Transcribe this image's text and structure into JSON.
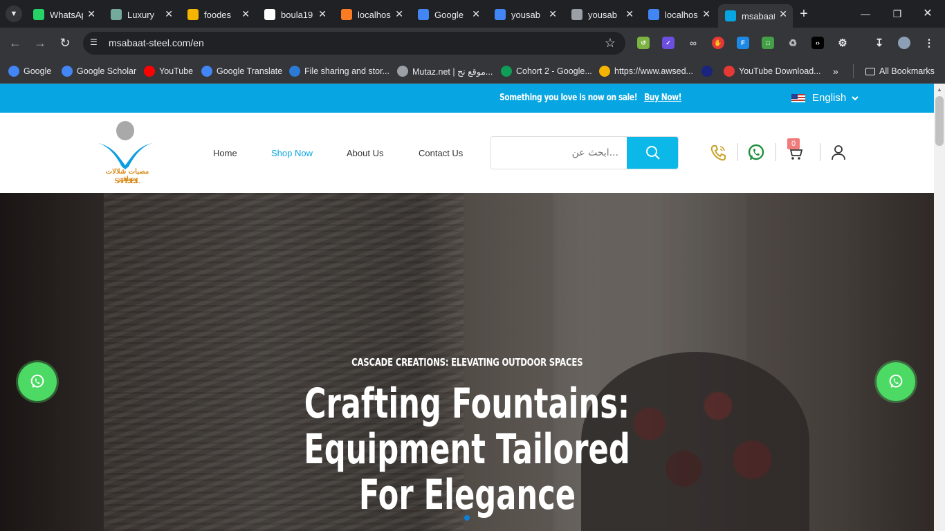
{
  "browser": {
    "tabs": [
      {
        "title": "WhatsApp",
        "favicon": "whatsapp-icon",
        "color": "#25d366",
        "active": false
      },
      {
        "title": "Luxury",
        "favicon": "openai-icon",
        "color": "#74aa9c",
        "active": false
      },
      {
        "title": "foodes",
        "favicon": "image-icon",
        "color": "#f4b400",
        "active": false
      },
      {
        "title": "boula19",
        "favicon": "github-icon",
        "color": "#ffffff",
        "active": false
      },
      {
        "title": "localhost",
        "favicon": "xampp-icon",
        "color": "#fb7a24",
        "active": false
      },
      {
        "title": "Google",
        "favicon": "google-translate-icon",
        "color": "#4285f4",
        "active": false
      },
      {
        "title": "yousab",
        "favicon": "link-icon",
        "color": "#4285f4",
        "active": false
      },
      {
        "title": "yousab",
        "favicon": "globe-icon",
        "color": "#9aa0a6",
        "active": false
      },
      {
        "title": "localhost",
        "favicon": "link-icon",
        "color": "#4285f4",
        "active": false
      },
      {
        "title": "msabaat",
        "favicon": "msabaat-logo-icon",
        "color": "#07a6e3",
        "active": true
      }
    ],
    "address": "msabaat-steel.com/en",
    "bookmarks": [
      {
        "label": "Google",
        "color": "#4285f4"
      },
      {
        "label": "Google Scholar",
        "color": "#4285f4"
      },
      {
        "label": "YouTube",
        "color": "#ff0000"
      },
      {
        "label": "Google Translate",
        "color": "#4285f4"
      },
      {
        "label": "File sharing and stor...",
        "color": "#2b7bd6"
      },
      {
        "label": "Mutaz.net | موقع تح...",
        "color": "#9aa0a6"
      },
      {
        "label": "Cohort 2 - Google...",
        "color": "#0f9d58"
      },
      {
        "label": "https://www.awsed...",
        "color": "#f4b400"
      },
      {
        "label": "",
        "color": "#1a237e"
      },
      {
        "label": "YouTube Download...",
        "color": "#e53935"
      }
    ],
    "all_bookmarks": "All Bookmarks"
  },
  "promo": {
    "message": "Something you love is now on sale!",
    "cta": "Buy Now!",
    "language": "English"
  },
  "header": {
    "logo_arabic": "مصبات شلالات ونوافير",
    "logo_english": "STEEL",
    "nav": [
      "Home",
      "Shop Now",
      "About Us",
      "Contact Us"
    ],
    "active_nav": "Shop Now",
    "search_placeholder": "...ابحث عن",
    "cart_count": "0"
  },
  "hero": {
    "subtitle": "CASCADE CREATIONS: ELEVATING OUTDOOR SPACES",
    "title_line1": "Crafting Fountains: Equipment Tailored",
    "title_line2": "For Elegance"
  },
  "colors": {
    "brand_blue": "#07a6e3",
    "search_button": "#0bb8e8",
    "whatsapp_green": "#4cd964",
    "cart_badge": "#f07b7b"
  }
}
